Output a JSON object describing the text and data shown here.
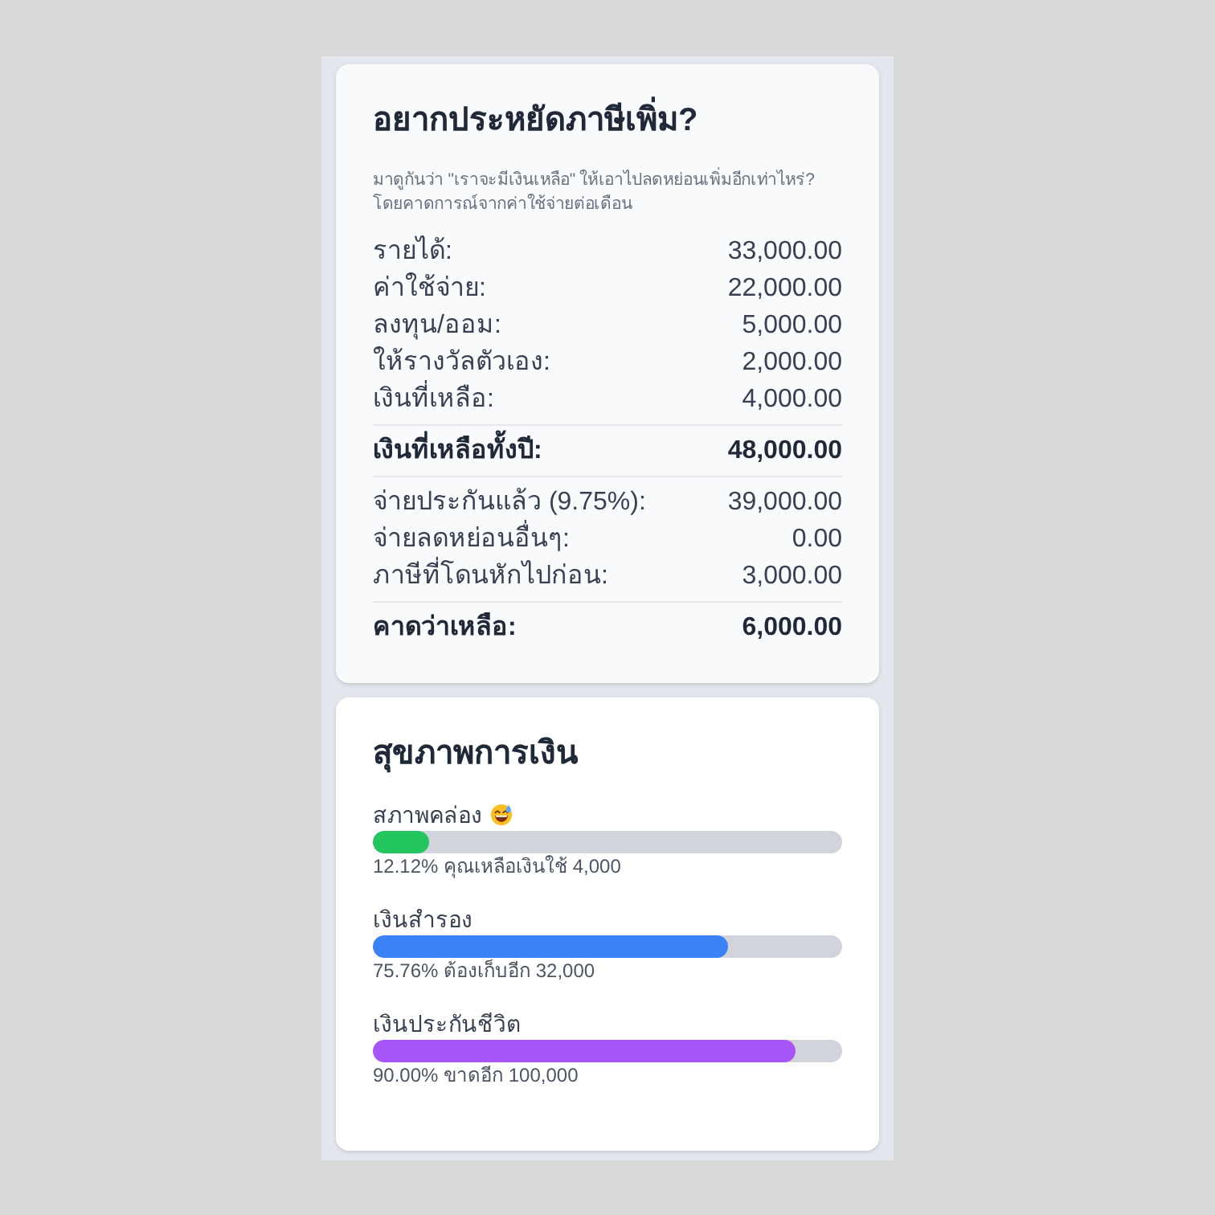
{
  "tax_card": {
    "title": "อยากประหยัดภาษีเพิ่ม?",
    "description": "มาดูกันว่า \"เราจะมีเงินเหลือ\" ให้เอาไปลดหย่อนเพิ่มอีกเท่าไหร่?\nโดยคาดการณ์จากค่าใช้จ่ายต่อเดือน",
    "groups": [
      {
        "rows": [
          {
            "kind": "item",
            "label": "รายได้:",
            "value": "33,000.00"
          },
          {
            "kind": "item",
            "label": "ค่าใช้จ่าย:",
            "value": "22,000.00"
          },
          {
            "kind": "item",
            "label": "ลงทุน/ออม:",
            "value": "5,000.00"
          },
          {
            "kind": "item",
            "label": "ให้รางวัลตัวเอง:",
            "value": "2,000.00"
          },
          {
            "kind": "item",
            "label": "เงินที่เหลือ:",
            "value": "4,000.00"
          }
        ]
      },
      {
        "rows": [
          {
            "kind": "total",
            "label": "เงินที่เหลือทั้งปี:",
            "value": "48,000.00"
          }
        ]
      },
      {
        "rows": [
          {
            "kind": "item",
            "label": "จ่ายประกันแล้ว (9.75%):",
            "value": "39,000.00"
          },
          {
            "kind": "item",
            "label": "จ่ายลดหย่อนอื่นๆ:",
            "value": "0.00"
          },
          {
            "kind": "item",
            "label": "ภาษีที่โดนหักไปก่อน:",
            "value": "3,000.00"
          }
        ]
      },
      {
        "rows": [
          {
            "kind": "total",
            "label": "คาดว่าเหลือ:",
            "value": "6,000.00"
          }
        ]
      }
    ]
  },
  "health_card": {
    "title": "สุขภาพการเงิน",
    "meters": [
      {
        "kind": "emoji",
        "label": "สภาพคล่อง",
        "level": 0.1212,
        "color": "#22c55e",
        "caption": "12.12% คุณเหลือเงินใช้ 4,000"
      },
      {
        "kind": "plain",
        "label": "เงินสำรอง",
        "level": 0.7576,
        "color": "#3b82f6",
        "caption": "75.76% ต้องเก็บอีก 32,000"
      },
      {
        "kind": "plain",
        "label": "เงินประกันชีวิต",
        "level": 0.9,
        "color": "#a855f7",
        "caption": "90.00% ขาดอีก 100,000"
      }
    ]
  }
}
